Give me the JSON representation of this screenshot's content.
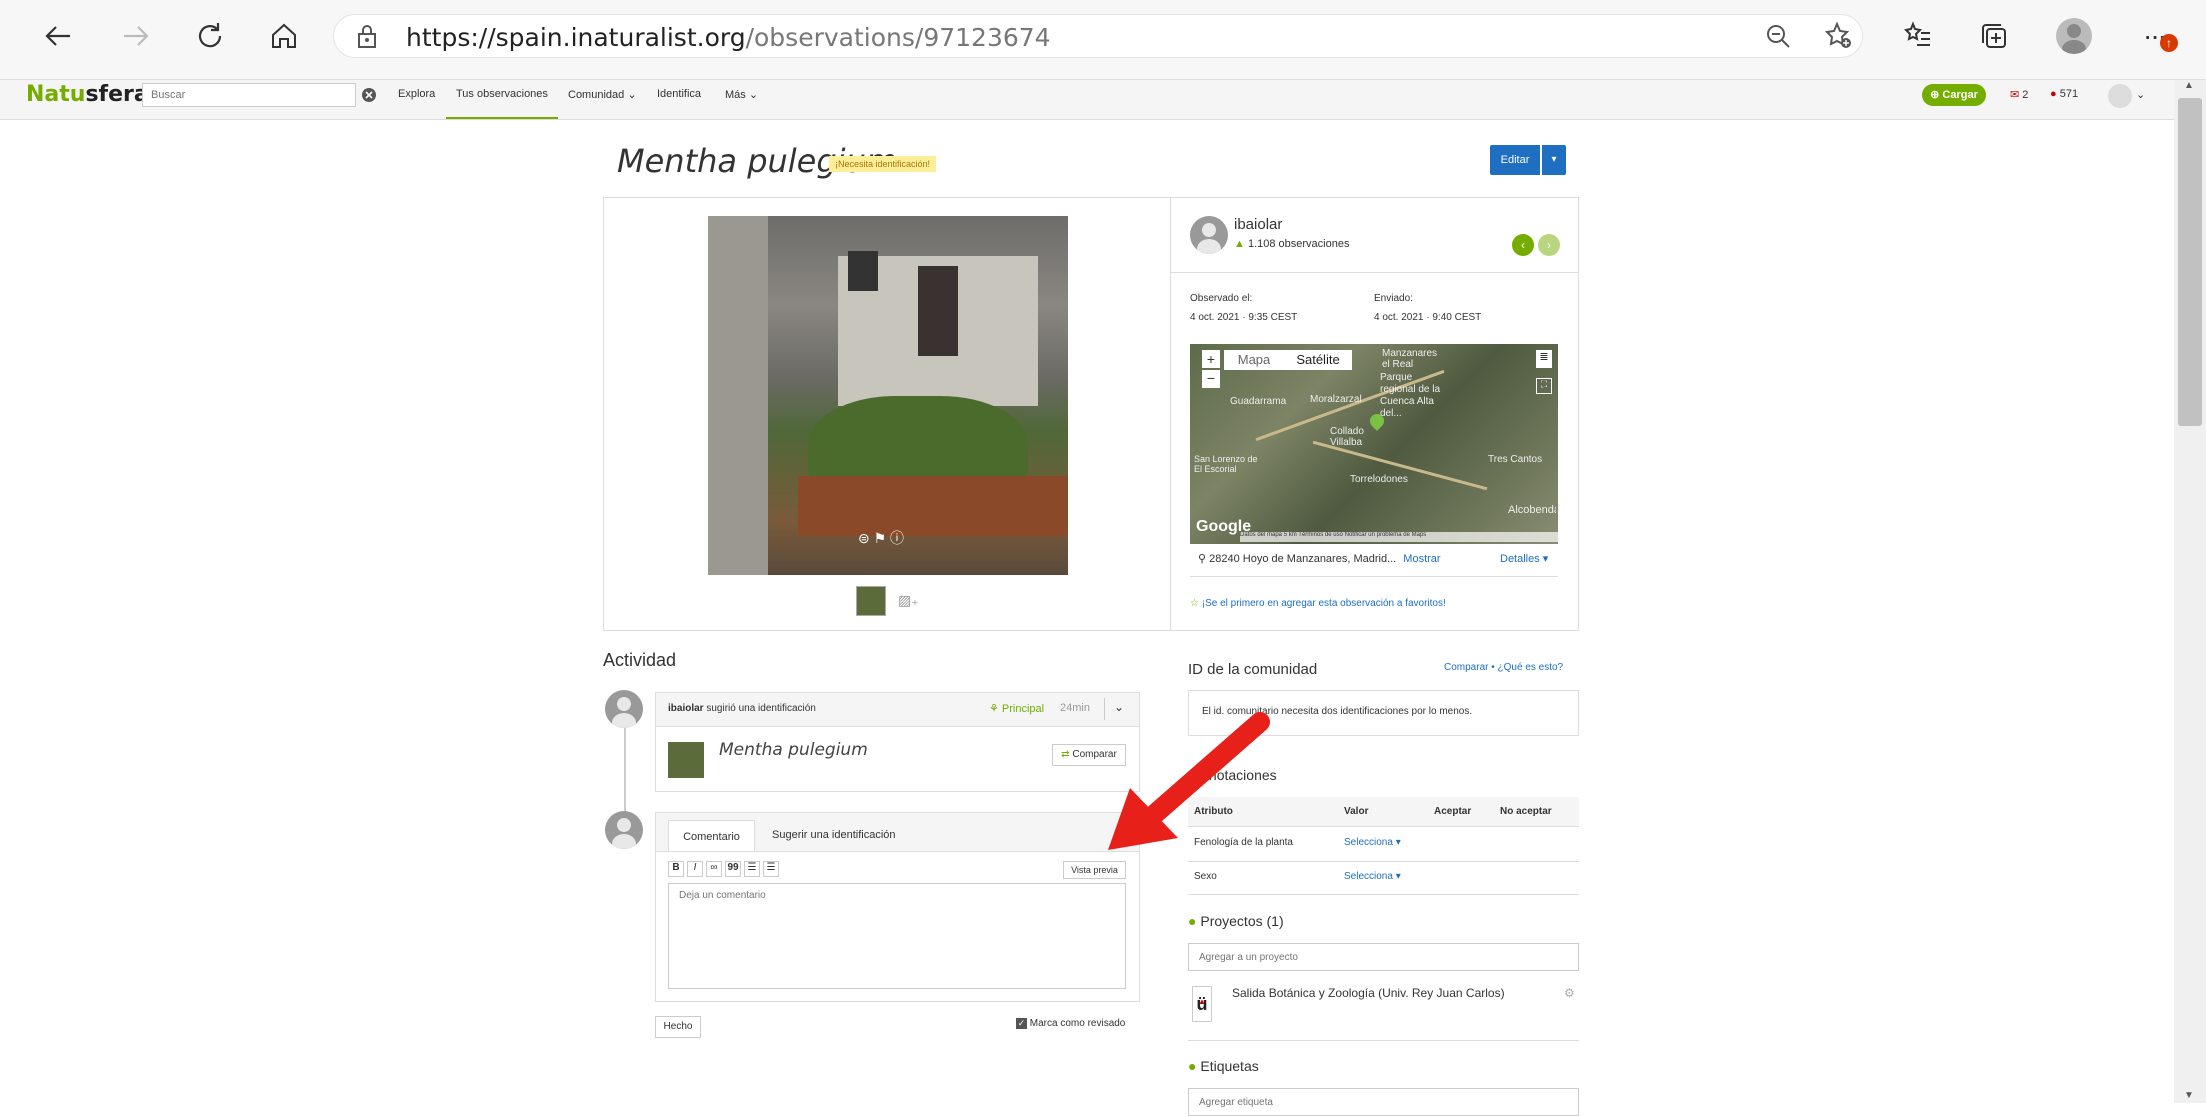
{
  "browser": {
    "url_host": "https://spain.inaturalist.org",
    "url_path": "/observations/97123674"
  },
  "site": {
    "logo_a": "Natu",
    "logo_b": "sfera",
    "search_placeholder": "Buscar",
    "nav": [
      "Explora",
      "Tus observaciones",
      "Comunidad",
      "Identifica",
      "Más"
    ],
    "upload": "Cargar",
    "messages_count": "2",
    "notifications_count": "571"
  },
  "observation": {
    "title": "Mentha pulegium",
    "badge": "¡Necesita identificación!",
    "edit": "Editar",
    "user": "ibaiolar",
    "user_obs": "1.108 observaciones",
    "observed_label": "Observado el:",
    "observed_value": "4 oct. 2021 · 9:35 CEST",
    "submitted_label": "Enviado:",
    "submitted_value": "4 oct. 2021 · 9:40 CEST",
    "map_tab_map": "Mapa",
    "map_tab_satellite": "Satélite",
    "map_attrib": "Datos del mapa  5 km          Términos de uso   Notificar un problema de Maps",
    "map_labels": [
      "Manzanares el Real",
      "Guadarrama",
      "Moralzarzal",
      "Parque regional de la Cuenca Alta del...",
      "Collado Villalba",
      "Tres Cantos",
      "San Lorenzo de El Escorial",
      "Torrelodones",
      "Alcobendas"
    ],
    "location": "28240 Hoyo de Manzanares, Madrid...",
    "show": "Mostrar",
    "details": "Detalles",
    "fav": "¡Se el primero en agregar esta observación a favoritos!"
  },
  "activity": {
    "title": "Actividad",
    "id_user": "ibaiolar",
    "id_text": "sugirió una identificación",
    "principal": "Principal",
    "time": "24min",
    "taxon": "Mentha pulegium",
    "compare": "Comparar",
    "tab_comment": "Comentario",
    "tab_suggest": "Sugerir una identificación",
    "preview": "Vista previa",
    "comment_placeholder": "Deja un comentario",
    "done": "Hecho",
    "reviewed": "Marca como revisado",
    "toolbar": [
      "B",
      "I",
      "∞",
      "99",
      "☰",
      "☰"
    ]
  },
  "community": {
    "title": "ID de la comunidad",
    "compare": "Comparar",
    "what": "¿Qué es esto?",
    "needs": "El id. comunitario necesita dos identificaciones por lo menos.",
    "annotations": "Anotaciones",
    "col_attr": "Atributo",
    "col_value": "Valor",
    "col_agree": "Aceptar",
    "col_disagree": "No aceptar",
    "row1": "Fenología de la planta",
    "row2": "Sexo",
    "select": "Selecciona",
    "projects": "Proyectos (1)",
    "add_project": "Agregar a un proyecto",
    "project_name": "Salida Botánica y Zoología (Univ. Rey Juan Carlos)",
    "tags": "Etiquetas",
    "add_tag": "Agregar etiqueta"
  },
  "colors": {
    "accent": "#74ac00",
    "blue": "#1e6fc1",
    "arrow": "#e8201a"
  }
}
